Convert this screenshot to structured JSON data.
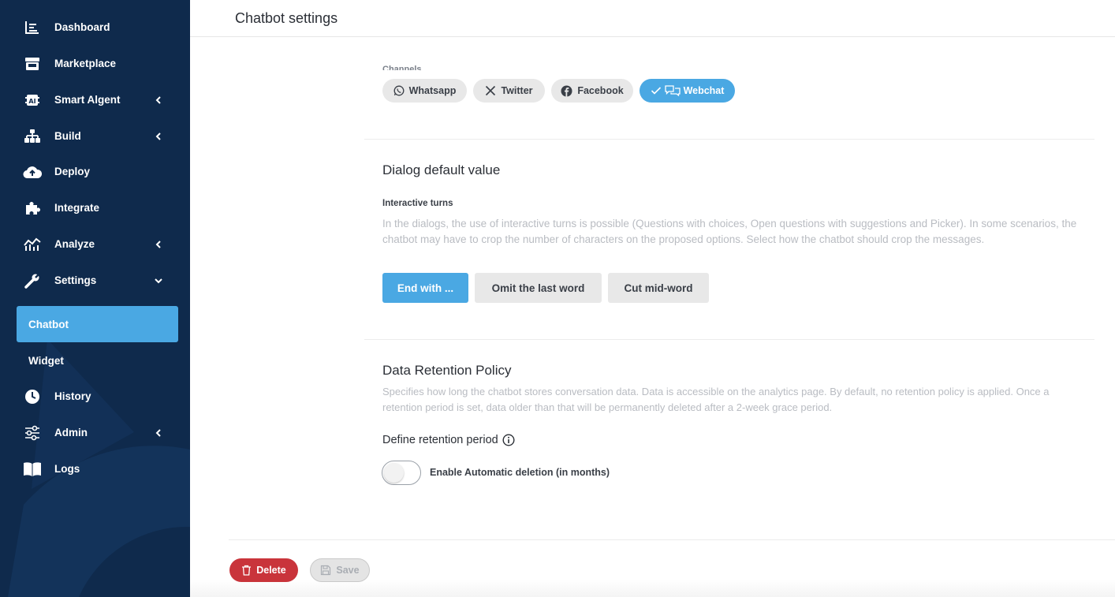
{
  "sidebar": {
    "items": [
      {
        "label": "Dashboard",
        "icon": "dashboard-icon"
      },
      {
        "label": "Marketplace",
        "icon": "store-icon"
      },
      {
        "label": "Smart Algent",
        "icon": "ai-icon",
        "chevron": "left"
      },
      {
        "label": "Build",
        "icon": "sitemap-icon",
        "chevron": "left"
      },
      {
        "label": "Deploy",
        "icon": "cloud-upload-icon"
      },
      {
        "label": "Integrate",
        "icon": "puzzle-icon"
      },
      {
        "label": "Analyze",
        "icon": "chart-line-icon",
        "chevron": "left"
      },
      {
        "label": "Settings",
        "icon": "wrench-icon",
        "chevron": "down"
      },
      {
        "label": "History",
        "icon": "clock-icon"
      },
      {
        "label": "Admin",
        "icon": "sliders-icon",
        "chevron": "left"
      },
      {
        "label": "Logs",
        "icon": "book-icon"
      }
    ],
    "settings_subitems": [
      {
        "label": "Chatbot",
        "active": true
      },
      {
        "label": "Widget",
        "active": false
      }
    ]
  },
  "header": {
    "title": "Chatbot settings"
  },
  "channels": {
    "label": "Channels",
    "items": [
      {
        "label": "Whatsapp",
        "icon": "whatsapp-icon",
        "active": false
      },
      {
        "label": "Twitter",
        "icon": "x-icon",
        "active": false
      },
      {
        "label": "Facebook",
        "icon": "facebook-icon",
        "active": false
      },
      {
        "label": "Webchat",
        "icon": "chat-bubbles-icon",
        "active": true
      }
    ]
  },
  "dialog": {
    "title": "Dialog default value",
    "subtitle": "Interactive turns",
    "description": "In the dialogs, the use of interactive turns is possible (Questions with choices, Open questions with suggestions and Picker). In some scenarios, the chatbot may have to crop the number of characters on the proposed options. Select how the chatbot should crop the messages.",
    "options": [
      {
        "label": "End with ...",
        "active": true
      },
      {
        "label": "Omit the last word",
        "active": false
      },
      {
        "label": "Cut mid-word",
        "active": false
      }
    ]
  },
  "retention": {
    "title": "Data Retention Policy",
    "description": "Specifies how long the chatbot stores conversation data. Data is accessible on the analytics page. By default, no retention policy is applied. Once a retention period is set, data older than that will be permanently deleted after a 2-week grace period.",
    "define_label": "Define retention period",
    "toggle_label": "Enable Automatic deletion (in months)",
    "toggle_on": false
  },
  "footer": {
    "delete_label": "Delete",
    "save_label": "Save"
  },
  "colors": {
    "sidebar_bg": "#0f2a4c",
    "accent": "#4aa8e3",
    "danger": "#c9343b"
  }
}
